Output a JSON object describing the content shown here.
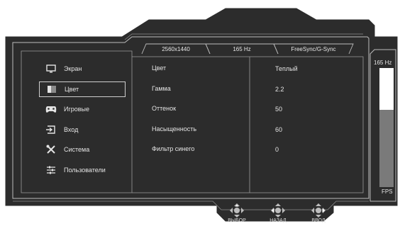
{
  "tabs": [
    {
      "label": "2560x1440"
    },
    {
      "label": "165 Hz"
    },
    {
      "label": "FreeSync/G-Sync"
    }
  ],
  "menu": [
    {
      "label": "Экран",
      "icon": "monitor-icon",
      "active": false
    },
    {
      "label": "Цвет",
      "icon": "color-icon",
      "active": true
    },
    {
      "label": "Игровые",
      "icon": "gamepad-icon",
      "active": false
    },
    {
      "label": "Вход",
      "icon": "input-icon",
      "active": false
    },
    {
      "label": "Система",
      "icon": "tools-icon",
      "active": false
    },
    {
      "label": "Пользователи",
      "icon": "sliders-icon",
      "active": false
    }
  ],
  "settings": [
    {
      "name": "Цвет",
      "value": "Теплый"
    },
    {
      "name": "Гамма",
      "value": "2.2"
    },
    {
      "name": "Оттенок",
      "value": "50"
    },
    {
      "name": "Насыщенность",
      "value": "60"
    },
    {
      "name": "Фильтр синего",
      "value": "0"
    }
  ],
  "fps_meter": {
    "top_label": "165 Hz",
    "bottom_label": "FPS",
    "level": 0.65
  },
  "hints": [
    {
      "label": "ВЫБОР",
      "icon": "dpad-icon"
    },
    {
      "label": "НАЗАД",
      "icon": "dpad-icon"
    },
    {
      "label": "ВВОД",
      "icon": "dpad-icon"
    }
  ],
  "colors": {
    "panel": "#2a2a2a",
    "border": "#bdbdbd",
    "text": "#e4e4e4",
    "fps_fill": "#7a7a7a"
  }
}
